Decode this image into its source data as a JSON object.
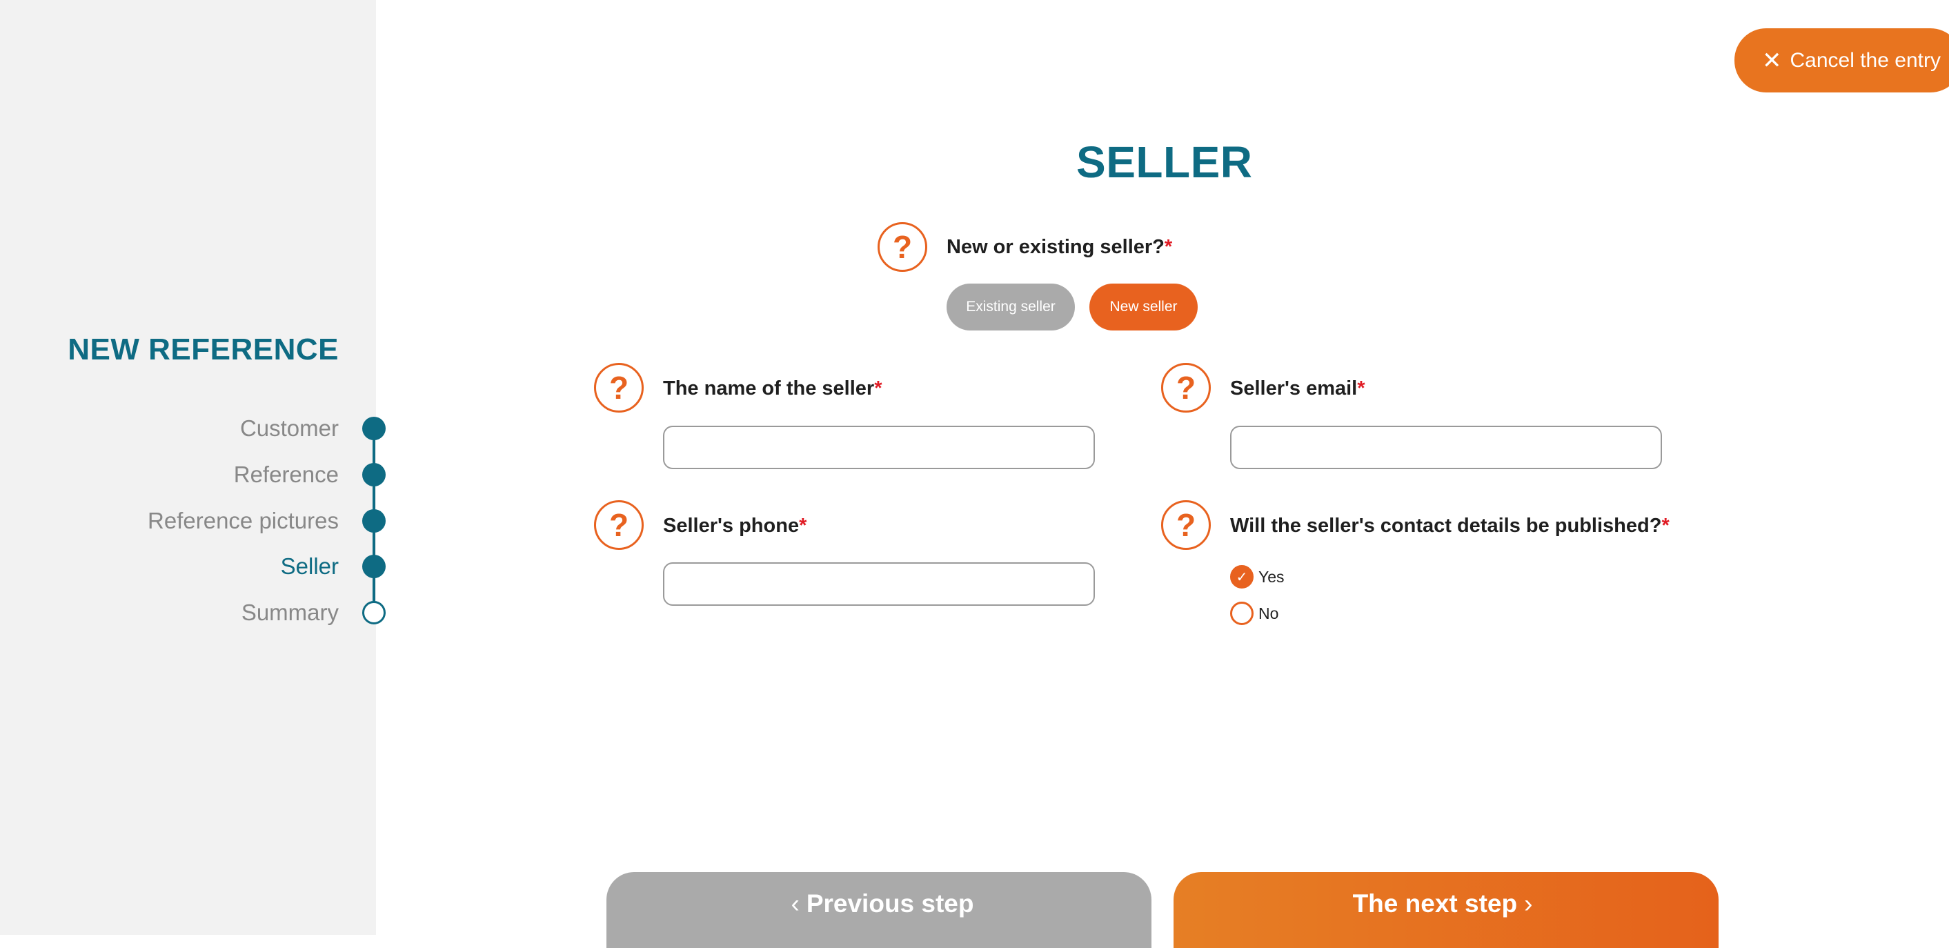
{
  "sidebar": {
    "title": "NEW REFERENCE",
    "steps": [
      {
        "label": "Customer",
        "state": "done"
      },
      {
        "label": "Reference",
        "state": "done"
      },
      {
        "label": "Reference pictures",
        "state": "done"
      },
      {
        "label": "Seller",
        "state": "current"
      },
      {
        "label": "Summary",
        "state": "pending"
      }
    ]
  },
  "header": {
    "cancel_label": "Cancel the entry",
    "cancel_icon": "close-icon"
  },
  "main": {
    "title": "SELLER",
    "seller_type": {
      "label": "New or existing seller?",
      "required_mark": "*",
      "options": [
        "Existing seller",
        "New seller"
      ],
      "selected": "New seller"
    },
    "fields": {
      "name": {
        "label": "The name of the seller",
        "required_mark": "*",
        "value": ""
      },
      "email": {
        "label": "Seller's email",
        "required_mark": "*",
        "value": ""
      },
      "phone": {
        "label": "Seller's phone",
        "required_mark": "*",
        "value": ""
      },
      "publish": {
        "label": "Will the seller's contact details be published?",
        "required_mark": "*",
        "options": [
          "Yes",
          "No"
        ],
        "selected": "Yes"
      }
    },
    "help_icon_glyph": "?"
  },
  "footer": {
    "prev_label": "Previous step",
    "next_label": "The next step",
    "prev_chevron": "‹",
    "next_chevron": "›"
  },
  "colors": {
    "primary_teal": "#0e6b83",
    "accent_orange": "#e8621f",
    "neutral_gray": "#aaaaaa",
    "sidebar_bg": "#f2f2f2",
    "required_red": "#e01b24"
  }
}
